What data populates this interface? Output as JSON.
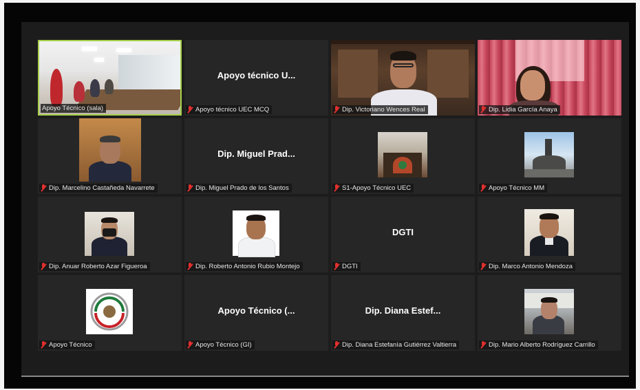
{
  "colors": {
    "active_speaker_border": "#a6d14a",
    "muted_icon": "#e0302e",
    "tile_background": "#262626"
  },
  "tiles": [
    {
      "display_name": "",
      "label": "Apoyo Técnico (sala)",
      "muted": false,
      "active": true
    },
    {
      "display_name": "Apoyo técnico U...",
      "label": "Apoyo técnico UEC MCQ",
      "muted": true
    },
    {
      "display_name": "",
      "label": "Dip. Victoriano Wences Real",
      "muted": true
    },
    {
      "display_name": "",
      "label": "Dip. Lidia García Anaya",
      "muted": true
    },
    {
      "display_name": "",
      "label": "Dip. Marcelino Castañeda Navarrete",
      "muted": true
    },
    {
      "display_name": "Dip. Miguel Prad...",
      "label": "Dip. Miguel Prado de los Santos",
      "muted": true
    },
    {
      "display_name": "",
      "label": "S1-Apoyo Técnico UEC",
      "muted": true
    },
    {
      "display_name": "",
      "label": "Apoyo Técnico MM",
      "muted": true
    },
    {
      "display_name": "",
      "label": "Dip. Anuar Roberto Azar Figueroa",
      "muted": true
    },
    {
      "display_name": "",
      "label": "Dip. Roberto Antonio Rubio Montejo",
      "muted": true
    },
    {
      "display_name": "DGTI",
      "label": "DGTI",
      "muted": true
    },
    {
      "display_name": "",
      "label": "Dip. Marco Antonio Mendoza",
      "muted": true
    },
    {
      "display_name": "",
      "label": "Apoyo Técnico",
      "muted": true
    },
    {
      "display_name": "Apoyo Técnico (...",
      "label": "Apoyo Técnico (GI)",
      "muted": true
    },
    {
      "display_name": "Dip. Diana Estef...",
      "label": "Dip. Diana Estefanía Gutiérrez Valtierra",
      "muted": true
    },
    {
      "display_name": "",
      "label": "Dip. Mario Alberto Rodríguez Carrillo",
      "muted": true
    }
  ]
}
